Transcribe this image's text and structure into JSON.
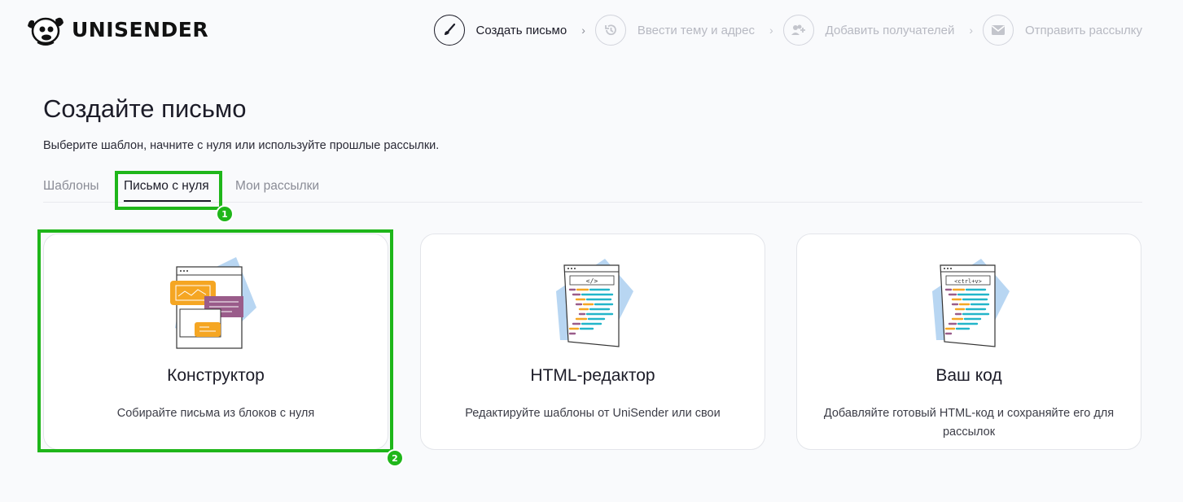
{
  "brand": {
    "name": "UNISENDER"
  },
  "steps": [
    {
      "label": "Создать письмо",
      "icon": "brush-icon",
      "active": true
    },
    {
      "label": "Ввести тему и адрес",
      "icon": "history-icon",
      "active": false
    },
    {
      "label": "Добавить получателей",
      "icon": "add-users-icon",
      "active": false
    },
    {
      "label": "Отправить рассылку",
      "icon": "envelope-icon",
      "active": false
    }
  ],
  "page": {
    "title": "Создайте письмо",
    "subtitle": "Выберите шаблон, начните с нуля или используйте прошлые рассылки."
  },
  "tabs": [
    {
      "label": "Шаблоны",
      "active": false
    },
    {
      "label": "Письмо с нуля",
      "active": true
    },
    {
      "label": "Мои рассылки",
      "active": false
    }
  ],
  "cards": [
    {
      "title": "Конструктор",
      "description": "Собирайте письма из блоков с нуля",
      "illustration": "constructor-illustration"
    },
    {
      "title": "HTML-редактор",
      "description": "Редактируйте шаблоны от UniSender или свои",
      "illustration": "html-code-illustration",
      "code_tag": "</>"
    },
    {
      "title": "Ваш код",
      "description": "Добавляйте готовый HTML-код и сохраняйте его для рассылок",
      "illustration": "your-code-illustration",
      "code_tag": "<ctrl+v>"
    }
  ],
  "annotations": [
    {
      "number": "1"
    },
    {
      "number": "2"
    }
  ],
  "colors": {
    "highlight": "#1fb61a",
    "accent_blue": "#b8d6f2",
    "orange": "#f5a623",
    "purple": "#9a5c8a",
    "teal": "#23b5c9"
  }
}
